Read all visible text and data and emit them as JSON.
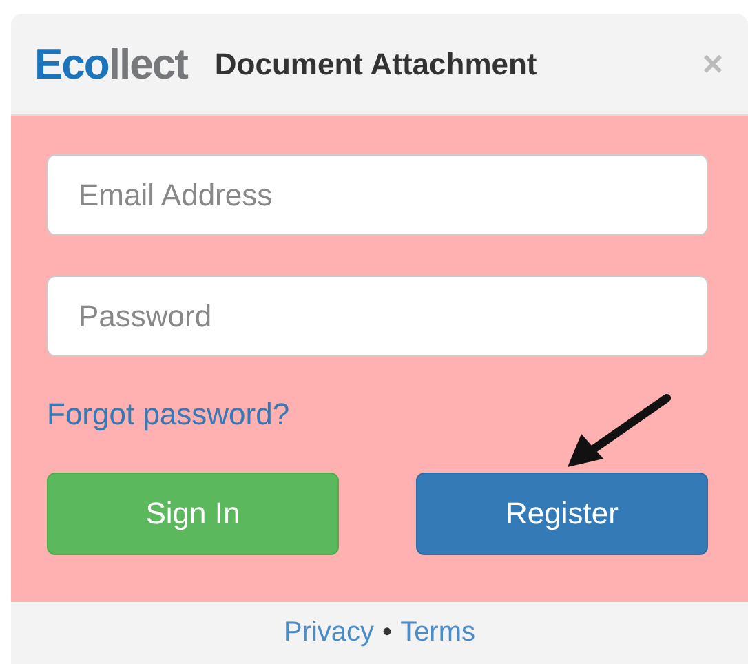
{
  "window": {
    "logo": [
      "Eco",
      "llect"
    ],
    "title": "Document Attachment",
    "close": "×"
  },
  "form": {
    "email": {
      "placeholder": "Email Address"
    },
    "password": {
      "placeholder": "Password"
    },
    "forgot_link": "Forgot password?",
    "buttons": [
      {
        "label": "Sign In",
        "kind": "success"
      },
      {
        "label": "Register",
        "kind": "primary"
      }
    ]
  },
  "footer": {
    "links": [
      "Privacy",
      "Terms"
    ],
    "separator": "•"
  }
}
